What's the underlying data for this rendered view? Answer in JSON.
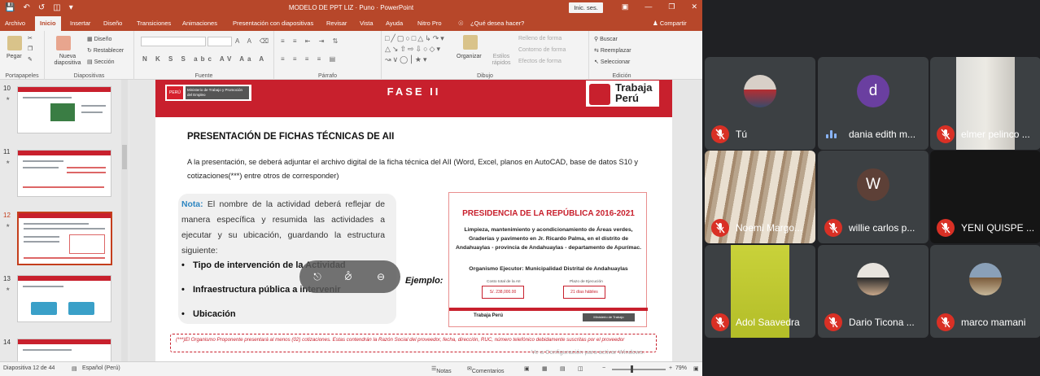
{
  "window": {
    "title": "MODELO DE PPT LIZ · Puno · PowerPoint",
    "signin": "Inic. ses."
  },
  "menu": {
    "tabs": [
      "Archivo",
      "Inicio",
      "Insertar",
      "Diseño",
      "Transiciones",
      "Animaciones",
      "Presentación con diapositivas",
      "Revisar",
      "Vista",
      "Ayuda",
      "Nitro Pro"
    ],
    "tell_me": "¿Qué desea hacer?",
    "share": "Compartir"
  },
  "ribbon": {
    "groups": {
      "clipboard": "Portapapeles",
      "slides": "Diapositivas",
      "font": "Fuente",
      "paragraph": "Párrafo",
      "drawing": "Dibujo",
      "editing": "Edición"
    },
    "paste": "Pegar",
    "new_slide": "Nueva diapositiva",
    "design": "Diseño",
    "reset": "Restablecer",
    "section": "Sección",
    "arrange": "Organizar",
    "quick_styles": "Estilos rápidos",
    "fill": "Relleno de forma",
    "outline": "Contorno de forma",
    "effects": "Efectos de forma",
    "find": "Buscar",
    "replace": "Reemplazar",
    "select": "Seleccionar"
  },
  "thumbnails": [
    {
      "num": "10",
      "selected": false
    },
    {
      "num": "11",
      "selected": false
    },
    {
      "num": "12",
      "selected": true
    },
    {
      "num": "13",
      "selected": false
    },
    {
      "num": "14",
      "selected": false
    }
  ],
  "slide": {
    "phase": "FASE II",
    "ministry_flag": "PERÚ",
    "ministry_name": "Ministerio de Trabajo y Promoción del Empleo",
    "logo_text_1": "Trabaja",
    "logo_text_2": "Perú",
    "headline": "PRESENTACIÓN DE FICHAS TÉCNICAS DE AII",
    "intro": "A la presentación, se deberá adjuntar el archivo digital de la ficha técnica del AII (Word, Excel, planos en AutoCAD, base de datos S10 y cotizaciones(***) entre otros de corresponder)",
    "note_label": "Nota:",
    "note_text": " El nombre de la actividad deberá reflejar de manera específica y resumida las actividades a ejecutar y su ubicación, guardando la estructura siguiente:",
    "bullets": [
      "Tipo de intervención de la Actividad",
      "Infraestructura pública a intervenir",
      "Ubicación"
    ],
    "example_label": "Ejemplo:",
    "example": {
      "title": "PRESIDENCIA DE LA REPÚBLICA 2016-2021",
      "body": "Limpieza, mantenimiento y acondicionamiento de Áreas verdes, Graderías y pavimento en Jr. Ricardo Palma, en el distrito de Andahuaylas - provincia de Andahuaylas - departamento de Apurímac.",
      "org": "Organismo Ejecutor: Municipalidad Distrital de Andahuaylas",
      "cost_label": "Costo total de la AII",
      "cost_value": "S/. 238,000.00",
      "term_label": "Plazo de Ejecución",
      "term_value": "21 días hábiles",
      "logo": "Trabaja Perú",
      "ministry": "Ministerio de Trabajo"
    },
    "footnote": "(***)El Organismo Proponente presentará al menos (02) cotizaciones. Estas contendrán la Razón Social del proveedor, fecha, dirección, RUC, número telefónico debidamente suscritas por el proveedor",
    "watermark": "Ve a Configuración para activar Windows."
  },
  "status": {
    "slide_count": "Diapositiva 12 de 44",
    "language": "Español (Perú)",
    "notes": "Notas",
    "comments": "Comentarios",
    "zoom": "79%"
  },
  "participants": [
    {
      "name": "Tú",
      "type": "photo",
      "muted": true
    },
    {
      "name": "dania edith m...",
      "type": "avatar",
      "initial": "d",
      "color": "#6a3fa0",
      "muted": false,
      "speaking": true
    },
    {
      "name": "elmer pelinco ...",
      "type": "video",
      "muted": true
    },
    {
      "name": "Noemi Margo...",
      "type": "video",
      "muted": true
    },
    {
      "name": "willie carlos p...",
      "type": "avatar",
      "initial": "W",
      "color": "#5d4037",
      "muted": true
    },
    {
      "name": "YENI QUISPE ...",
      "type": "dark",
      "muted": true
    },
    {
      "name": "Adol Saavedra",
      "type": "video",
      "muted": true
    },
    {
      "name": "Dario Ticona ...",
      "type": "photo",
      "muted": true
    },
    {
      "name": "marco mamani",
      "type": "photo",
      "muted": true
    }
  ],
  "colors": {
    "ppt_accent": "#b7472a",
    "slide_red": "#c8202d",
    "muted_red": "#d93025",
    "meet_bg": "#202124",
    "tile_bg": "#3c4043"
  }
}
